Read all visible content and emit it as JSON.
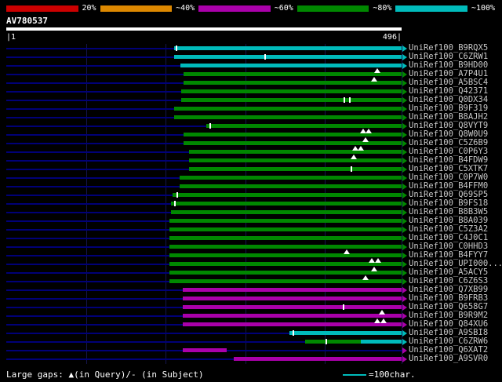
{
  "colors": {
    "red": "#cc0000",
    "orange": "#dd8800",
    "magenta": "#aa00aa",
    "green": "#008800",
    "cyan": "#00bbbb",
    "navy": "#000077",
    "white": "#ffffff"
  },
  "scale_bar": {
    "segments": [
      {
        "color": "red",
        "label": "20%"
      },
      {
        "color": "orange",
        "label": "~40%"
      },
      {
        "color": "magenta",
        "label": "~60%"
      },
      {
        "color": "green",
        "label": "~80%"
      },
      {
        "color": "cyan",
        "label": "~100%"
      }
    ]
  },
  "query": {
    "name": "AV780537",
    "start_label": "|1",
    "end_label": "496|"
  },
  "chart_data": {
    "type": "bar",
    "title": "AV780537",
    "x_range": [
      1,
      496
    ],
    "grid_positions": [
      100,
      200,
      300,
      400,
      496
    ],
    "hits": [
      {
        "id": "UniRef100_B9RQX5",
        "arrow": "cyan",
        "segments": [
          {
            "color": "cyan",
            "start": 211,
            "end": 496
          }
        ],
        "ticks": [
          214
        ]
      },
      {
        "id": "UniRef100_C6ZRW1",
        "arrow": "cyan",
        "segments": [
          {
            "color": "cyan",
            "start": 211,
            "end": 496
          }
        ],
        "ticks": [
          325
        ]
      },
      {
        "id": "UniRef100_B9HD00",
        "arrow": "cyan",
        "segments": [
          {
            "color": "cyan",
            "start": 218,
            "end": 496
          }
        ]
      },
      {
        "id": "UniRef100_A7P4U1",
        "arrow": "green",
        "segments": [
          {
            "color": "green",
            "start": 222,
            "end": 496
          }
        ],
        "gaps": [
          465
        ]
      },
      {
        "id": "UniRef100_A5BSC4",
        "arrow": "green",
        "segments": [
          {
            "color": "green",
            "start": 222,
            "end": 496
          }
        ],
        "gaps": [
          462
        ]
      },
      {
        "id": "UniRef100_Q42371",
        "arrow": "green",
        "segments": [
          {
            "color": "green",
            "start": 219,
            "end": 496
          }
        ]
      },
      {
        "id": "UniRef100_Q0DX34",
        "arrow": "green",
        "segments": [
          {
            "color": "green",
            "start": 219,
            "end": 496
          }
        ],
        "ticks": [
          424,
          431
        ]
      },
      {
        "id": "UniRef100_B9F319",
        "arrow": "green",
        "segments": [
          {
            "color": "green",
            "start": 211,
            "end": 496
          }
        ]
      },
      {
        "id": "UniRef100_B8AJH2",
        "arrow": "green",
        "segments": [
          {
            "color": "green",
            "start": 211,
            "end": 496
          }
        ]
      },
      {
        "id": "UniRef100_Q8VYT9",
        "arrow": "green",
        "segments": [
          {
            "color": "green",
            "start": 251,
            "end": 496
          }
        ],
        "ticks": [
          256
        ]
      },
      {
        "id": "UniRef100_Q8W0U9",
        "arrow": "green",
        "segments": [
          {
            "color": "green",
            "start": 222,
            "end": 496
          }
        ],
        "gaps": [
          448,
          455
        ]
      },
      {
        "id": "UniRef100_C5Z6B9",
        "arrow": "green",
        "segments": [
          {
            "color": "green",
            "start": 222,
            "end": 496
          }
        ],
        "gaps": [
          451
        ]
      },
      {
        "id": "UniRef100_C0P6Y3",
        "arrow": "green",
        "segments": [
          {
            "color": "green",
            "start": 229,
            "end": 496
          }
        ],
        "gaps": [
          438,
          445
        ]
      },
      {
        "id": "UniRef100_B4FDW9",
        "arrow": "green",
        "segments": [
          {
            "color": "green",
            "start": 229,
            "end": 496
          }
        ],
        "gaps": [
          436
        ]
      },
      {
        "id": "UniRef100_C5XTK7",
        "arrow": "green",
        "segments": [
          {
            "color": "green",
            "start": 229,
            "end": 496
          }
        ],
        "ticks": [
          433
        ]
      },
      {
        "id": "UniRef100_C0P7W0",
        "arrow": "green",
        "segments": [
          {
            "color": "green",
            "start": 217,
            "end": 496
          }
        ]
      },
      {
        "id": "UniRef100_B4FFM0",
        "arrow": "green",
        "segments": [
          {
            "color": "green",
            "start": 217,
            "end": 496
          }
        ]
      },
      {
        "id": "UniRef100_Q69SP5",
        "arrow": "green",
        "segments": [
          {
            "color": "green",
            "start": 209,
            "end": 496
          }
        ],
        "ticks": [
          215
        ]
      },
      {
        "id": "UniRef100_B9FS18",
        "arrow": "green",
        "segments": [
          {
            "color": "green",
            "start": 207,
            "end": 496
          }
        ],
        "ticks": [
          212
        ]
      },
      {
        "id": "UniRef100_B8B3W5",
        "arrow": "green",
        "segments": [
          {
            "color": "green",
            "start": 207,
            "end": 496
          }
        ]
      },
      {
        "id": "UniRef100_B8A039",
        "arrow": "green",
        "segments": [
          {
            "color": "green",
            "start": 205,
            "end": 496
          }
        ]
      },
      {
        "id": "UniRef100_C5Z3A2",
        "arrow": "green",
        "segments": [
          {
            "color": "green",
            "start": 205,
            "end": 496
          }
        ]
      },
      {
        "id": "UniRef100_C4J0C1",
        "arrow": "green",
        "segments": [
          {
            "color": "green",
            "start": 205,
            "end": 496
          }
        ]
      },
      {
        "id": "UniRef100_C0HHD3",
        "arrow": "green",
        "segments": [
          {
            "color": "green",
            "start": 205,
            "end": 496
          }
        ]
      },
      {
        "id": "UniRef100_B4FYY7",
        "arrow": "green",
        "segments": [
          {
            "color": "green",
            "start": 205,
            "end": 496
          }
        ],
        "gaps": [
          427
        ]
      },
      {
        "id": "UniRef100_UPI000...",
        "arrow": "green",
        "segments": [
          {
            "color": "green",
            "start": 205,
            "end": 496
          }
        ],
        "gaps": [
          459,
          466
        ]
      },
      {
        "id": "UniRef100_A5ACY5",
        "arrow": "green",
        "segments": [
          {
            "color": "green",
            "start": 205,
            "end": 496
          }
        ],
        "gaps": [
          462
        ]
      },
      {
        "id": "UniRef100_C6Z6S3",
        "arrow": "green",
        "segments": [
          {
            "color": "green",
            "start": 205,
            "end": 496
          }
        ],
        "gaps": [
          451
        ]
      },
      {
        "id": "UniRef100_Q7XB99",
        "arrow": "magenta",
        "segments": [
          {
            "color": "magenta",
            "start": 221,
            "end": 496
          }
        ]
      },
      {
        "id": "UniRef100_B9FRB3",
        "arrow": "magenta",
        "segments": [
          {
            "color": "magenta",
            "start": 221,
            "end": 496
          }
        ]
      },
      {
        "id": "UniRef100_Q658G7",
        "arrow": "magenta",
        "segments": [
          {
            "color": "magenta",
            "start": 221,
            "end": 496
          }
        ],
        "ticks": [
          423
        ]
      },
      {
        "id": "UniRef100_B9R9M2",
        "arrow": "magenta",
        "segments": [
          {
            "color": "magenta",
            "start": 221,
            "end": 496
          }
        ],
        "gaps": [
          471
        ]
      },
      {
        "id": "UniRef100_Q84XU6",
        "arrow": "magenta",
        "segments": [
          {
            "color": "magenta",
            "start": 221,
            "end": 496
          }
        ],
        "gaps": [
          465,
          473
        ]
      },
      {
        "id": "UniRef100_A9SBI8",
        "arrow": "cyan",
        "segments": [
          {
            "color": "cyan",
            "start": 355,
            "end": 496
          }
        ],
        "ticks": [
          360
        ]
      },
      {
        "id": "UniRef100_C6ZRW6",
        "arrow": "cyan",
        "segments": [
          {
            "color": "green",
            "start": 375,
            "end": 445
          },
          {
            "color": "cyan",
            "start": 445,
            "end": 496
          }
        ],
        "ticks": [
          402
        ]
      },
      {
        "id": "UniRef100_Q6XAT2",
        "arrow": "magenta",
        "segments": [
          {
            "color": "magenta",
            "start": 221,
            "end": 277
          }
        ]
      },
      {
        "id": "UniRef100_A9SVR0",
        "arrow": "magenta",
        "segments": [
          {
            "color": "magenta",
            "start": 285,
            "end": 496
          }
        ]
      }
    ]
  },
  "footer": {
    "gaps_legend": "Large gaps: ▲(in Query)/- (in Subject)",
    "scale_legend": "=100char."
  }
}
